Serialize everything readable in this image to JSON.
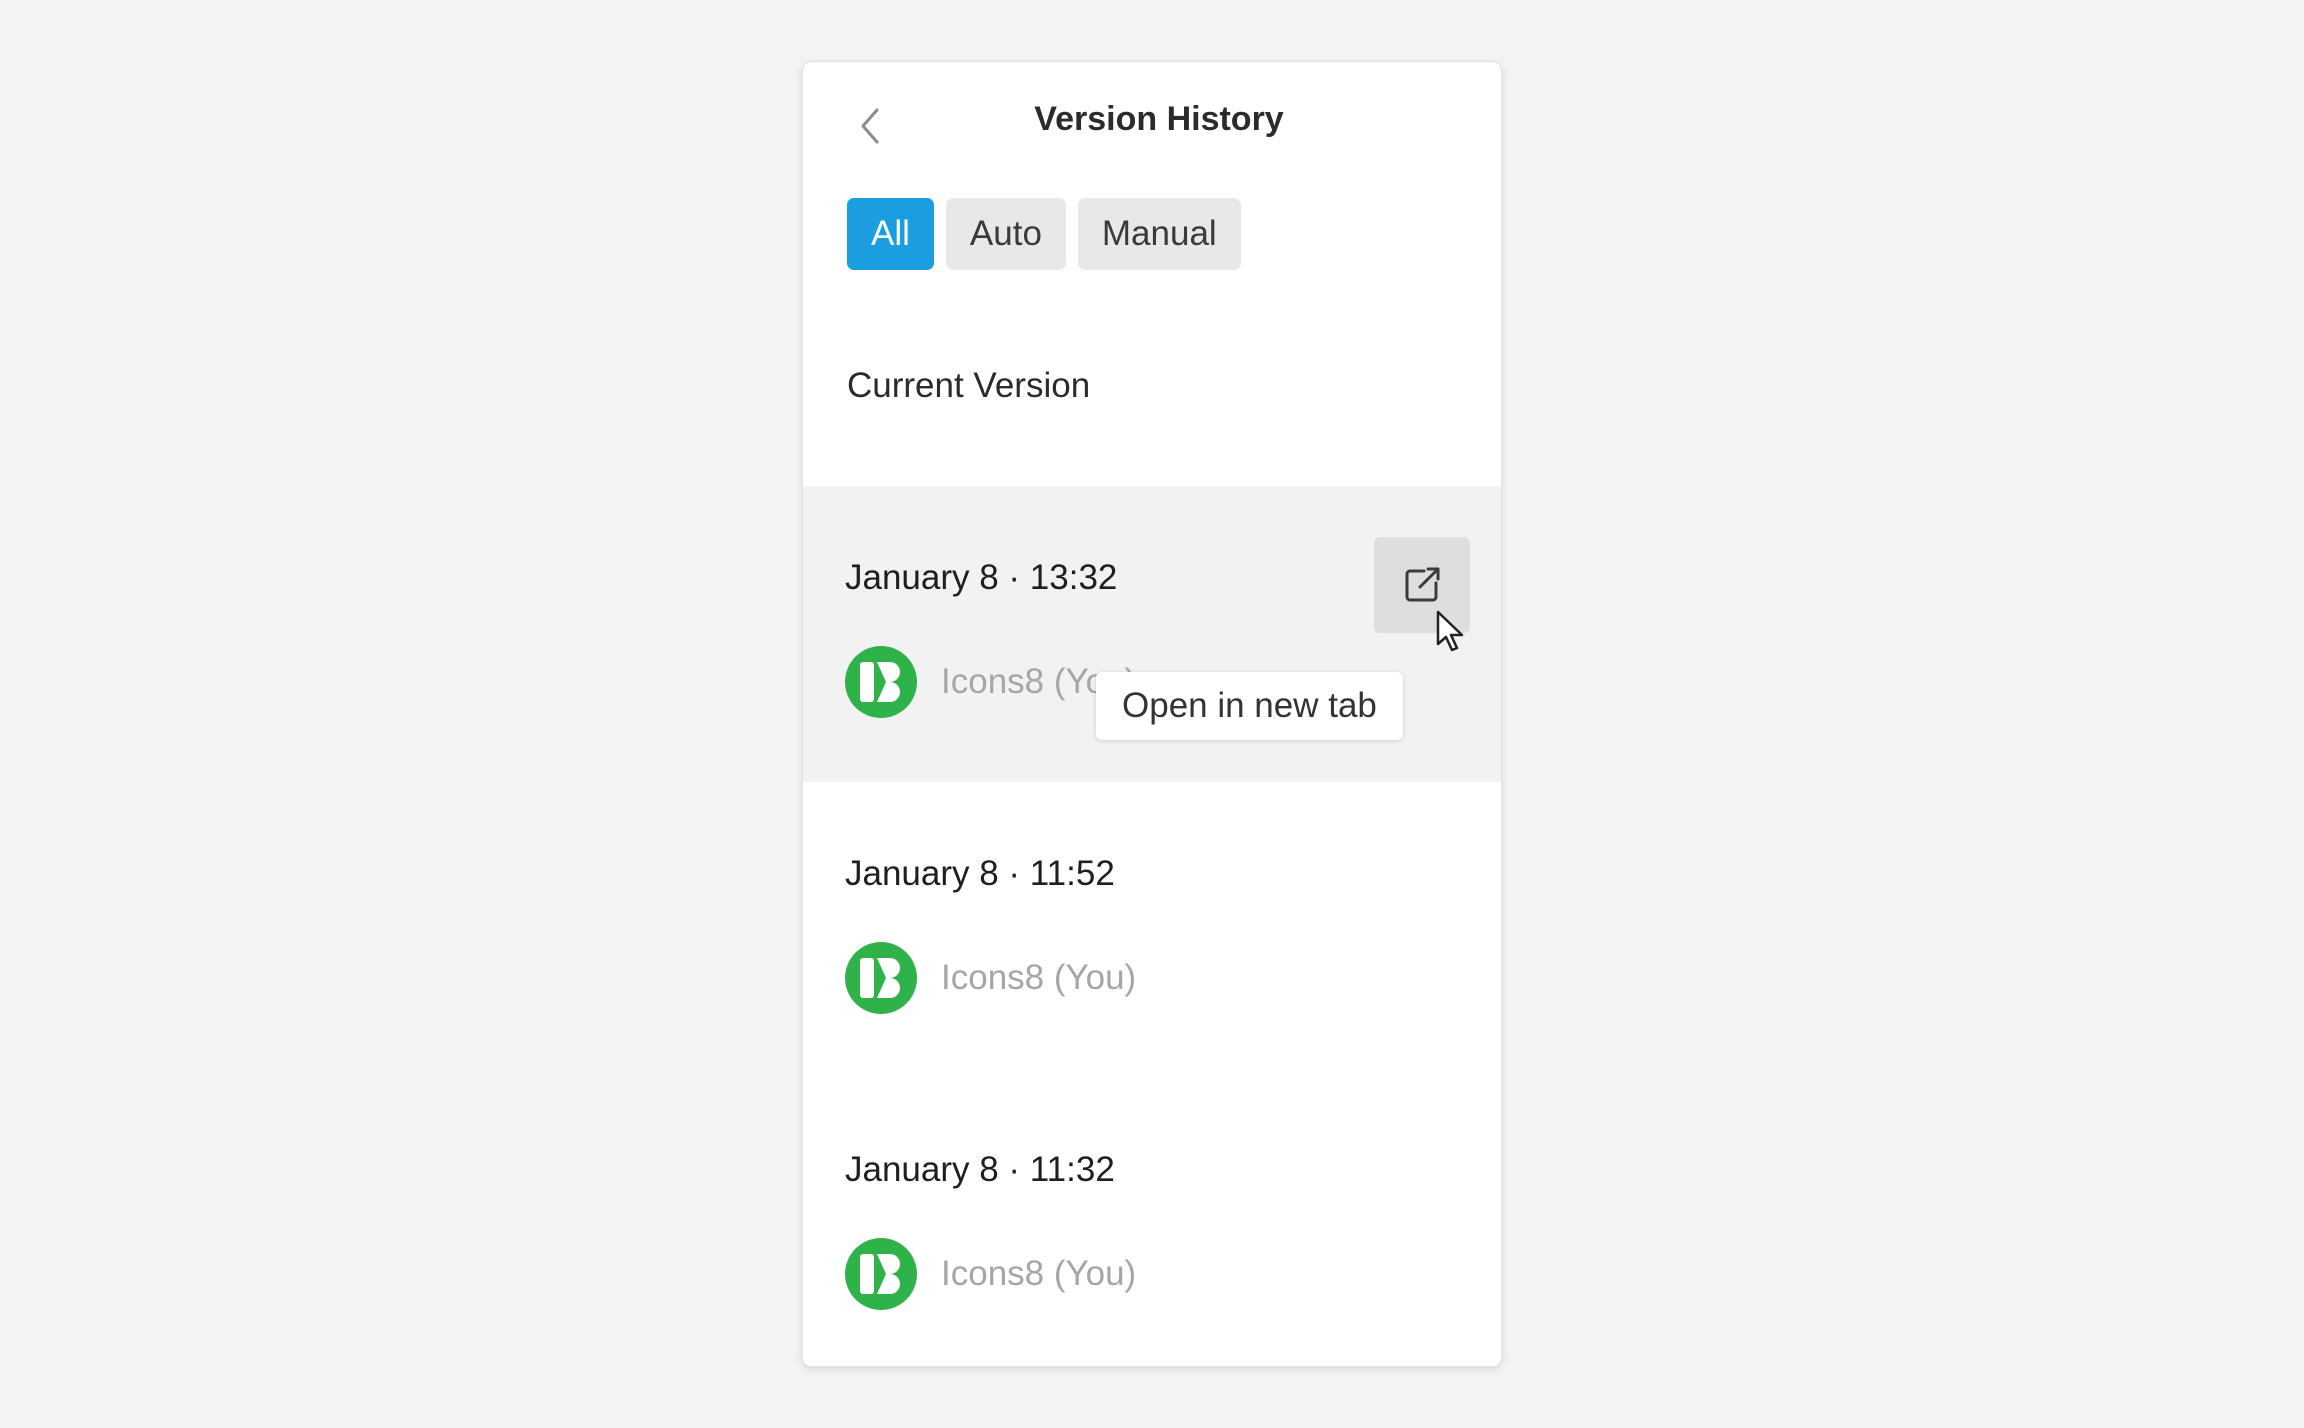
{
  "panel": {
    "title": "Version History",
    "back_icon": "chevron-left-icon"
  },
  "filters": [
    {
      "label": "All",
      "active": true
    },
    {
      "label": "Auto",
      "active": false
    },
    {
      "label": "Manual",
      "active": false
    }
  ],
  "current_version_label": "Current Version",
  "versions": [
    {
      "date": "January 8 · 13:32",
      "author": "Icons8 (You)",
      "avatar_icon": "icons8-logo-icon"
    },
    {
      "date": "January 8 · 11:52",
      "author": "Icons8 (You)",
      "avatar_icon": "icons8-logo-icon"
    },
    {
      "date": "January 8 · 11:32",
      "author": "Icons8 (You)",
      "avatar_icon": "icons8-logo-icon"
    }
  ],
  "open_in_new_tab": {
    "icon": "external-link-icon",
    "tooltip": "Open in new tab"
  },
  "colors": {
    "accent": "#1a9ee0",
    "avatar": "#2fb24a",
    "highlight_row": "#f2f2f2"
  }
}
